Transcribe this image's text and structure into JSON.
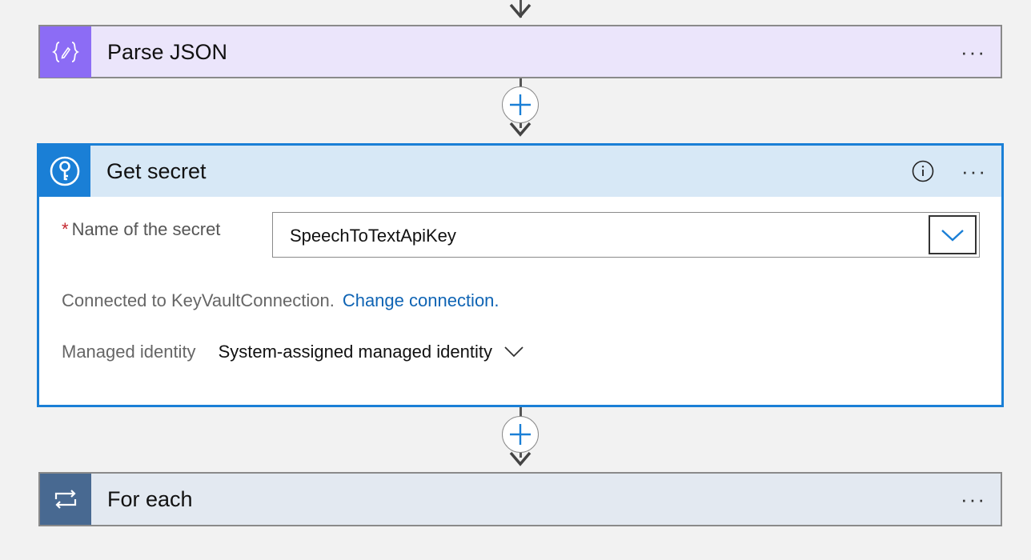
{
  "steps": {
    "parse_json": {
      "title": "Parse JSON",
      "icon": "braces-pencil-icon",
      "accent": "#8c6cf5",
      "more_label": "···"
    },
    "get_secret": {
      "title": "Get secret",
      "icon": "key-vault-icon",
      "accent": "#1a7fd6",
      "more_label": "···",
      "field": {
        "required_marker": "*",
        "label": "Name of the secret",
        "value": "SpeechToTextApiKey"
      },
      "connection": {
        "text": "Connected to KeyVaultConnection.",
        "change_link": "Change connection."
      },
      "managed_identity": {
        "label": "Managed identity",
        "value": "System-assigned managed identity"
      }
    },
    "for_each": {
      "title": "For each",
      "icon": "loop-icon",
      "accent": "#486991",
      "more_label": "···"
    }
  }
}
